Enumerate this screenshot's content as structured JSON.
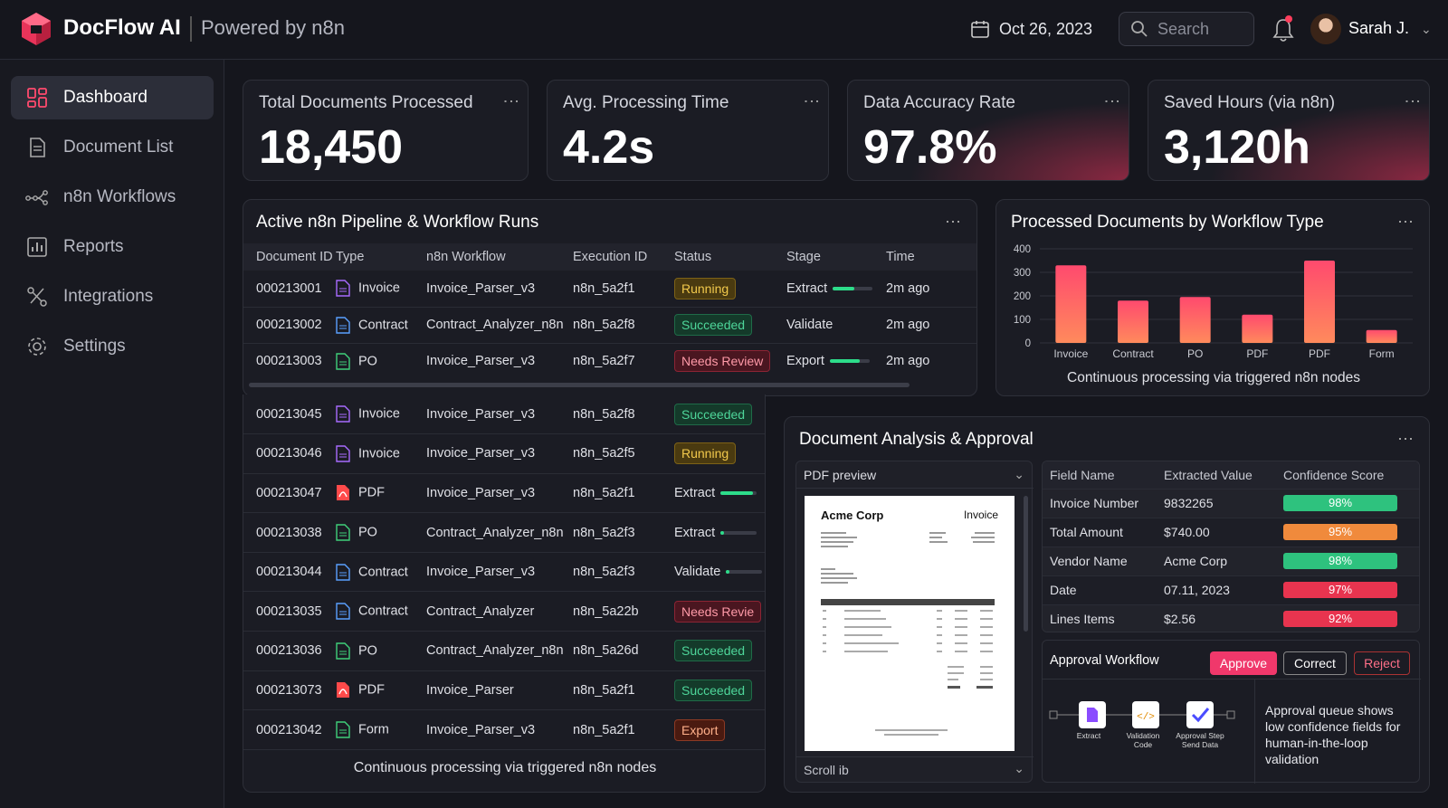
{
  "app": {
    "name": "DocFlow AI",
    "subtitle": "Powered by n8n"
  },
  "header": {
    "date": "Oct 26, 2023",
    "search_placeholder": "Search",
    "user": "Sarah J."
  },
  "sidebar": {
    "items": [
      {
        "label": "Dashboard",
        "icon": "dashboard-icon",
        "active": true
      },
      {
        "label": "Document List",
        "icon": "document-icon"
      },
      {
        "label": "n8n Workflows",
        "icon": "workflow-icon"
      },
      {
        "label": "Reports",
        "icon": "reports-icon"
      },
      {
        "label": "Integrations",
        "icon": "integrations-icon"
      },
      {
        "label": "Settings",
        "icon": "gear-icon"
      }
    ]
  },
  "kpis": [
    {
      "title": "Total Documents Processed",
      "value": "18,450"
    },
    {
      "title": "Avg. Processing Time",
      "value": "4.2s"
    },
    {
      "title": "Data Accuracy Rate",
      "value": "97.8%"
    },
    {
      "title": "Saved Hours (via n8n)",
      "value": "3,120h"
    }
  ],
  "pipeline": {
    "title": "Active n8n Pipeline & Workflow Runs",
    "columns": [
      "Document ID",
      "Type",
      "n8n Workflow",
      "Execution ID",
      "Status",
      "Stage",
      "Time"
    ],
    "rows": [
      {
        "id": "000213001",
        "type": "Invoice",
        "workflow": "Invoice_Parser_v3",
        "exec": "n8n_5a2f1",
        "status": "Running",
        "stage": "Extract",
        "progress": 0.55,
        "time": "2m ago"
      },
      {
        "id": "000213002",
        "type": "Contract",
        "workflow": "Contract_Analyzer_n8n",
        "exec": "n8n_5a2f8",
        "status": "Succeeded",
        "stage": "Validate",
        "progress": null,
        "time": "2m ago"
      },
      {
        "id": "000213003",
        "type": "PO",
        "workflow": "Invoice_Parser_v3",
        "exec": "n8n_5a2f7",
        "status": "Needs Review",
        "stage": "Export",
        "progress": 0.75,
        "time": "2m ago"
      }
    ],
    "more_rows": [
      {
        "id": "000213045",
        "type": "Invoice",
        "workflow": "Invoice_Parser_v3",
        "exec": "n8n_5a2f8",
        "status": "Succeeded",
        "stage": ""
      },
      {
        "id": "000213046",
        "type": "Invoice",
        "workflow": "Invoice_Parser_v3",
        "exec": "n8n_5a2f5",
        "status": "Running",
        "stage": ""
      },
      {
        "id": "000213047",
        "type": "PDF",
        "workflow": "Invoice_Parser_v3",
        "exec": "n8n_5a2f1",
        "status": "",
        "stage": "Extract"
      },
      {
        "id": "000213038",
        "type": "PO",
        "workflow": "Contract_Analyzer_n8n",
        "exec": "n8n_5a2f3",
        "status": "",
        "stage": "Extract"
      },
      {
        "id": "000213044",
        "type": "Contract",
        "workflow": "Invoice_Parser_v3",
        "exec": "n8n_5a2f3",
        "status": "",
        "stage": "Validate"
      },
      {
        "id": "000213035",
        "type": "Contract",
        "workflow": "Contract_Analyzer",
        "exec": "n8n_5a22b",
        "status": "Needs Revie",
        "stage": ""
      },
      {
        "id": "000213036",
        "type": "PO",
        "workflow": "Contract_Analyzer_n8n",
        "exec": "n8n_5a26d",
        "status": "Succeeded",
        "stage": ""
      },
      {
        "id": "000213073",
        "type": "PDF",
        "workflow": "Invoice_Parser",
        "exec": "n8n_5a2f1",
        "status": "Succeeded",
        "stage": ""
      },
      {
        "id": "000213042",
        "type": "Form",
        "workflow": "Invoice_Parser_v3",
        "exec": "n8n_5a2f1",
        "status": "Export",
        "stage": ""
      }
    ],
    "footer": "Continuous processing via triggered n8n nodes"
  },
  "chart_data": {
    "type": "bar",
    "title": "Processed Documents by Workflow Type",
    "categories": [
      "Invoice",
      "Contract",
      "PO",
      "PDF",
      "PDF",
      "Form"
    ],
    "values": [
      330,
      180,
      195,
      120,
      350,
      55
    ],
    "ylim": [
      0,
      400
    ],
    "yticks": [
      0,
      100,
      200,
      300,
      400
    ],
    "grid": true,
    "caption": "Continuous processing via triggered n8n nodes",
    "bar_color_top": "#ff4a6e",
    "bar_color_bottom": "#ff8a5c"
  },
  "analysis": {
    "title": "Document Analysis & Approval",
    "preview_label": "PDF preview",
    "scroll_label": "Scroll ib",
    "doc_company": "Acme Corp",
    "doc_kind": "Invoice",
    "columns": [
      "Field Name",
      "Extracted Value",
      "Confidence Score"
    ],
    "fields": [
      {
        "name": "Invoice Number",
        "value": "9832265",
        "confidence": "98%",
        "color": "#2ec27e"
      },
      {
        "name": "Total Amount",
        "value": "$740.00",
        "confidence": "95%",
        "color": "#f08a3c"
      },
      {
        "name": "Vendor Name",
        "value": "Acme Corp",
        "confidence": "98%",
        "color": "#2ec27e"
      },
      {
        "name": "Date",
        "value": "07.11, 2023",
        "confidence": "97%",
        "color": "#e8344f"
      },
      {
        "name": "Lines Items",
        "value": "$2.56",
        "confidence": "92%",
        "color": "#e8344f"
      }
    ],
    "approval": {
      "title": "Approval Workflow",
      "approve": "Approve",
      "correct": "Correct",
      "reject": "Reject",
      "steps": [
        "Extract",
        "Validation Code",
        "Approval Step Send Data"
      ],
      "note": "Approval queue shows low confidence fields for human-in-the-loop validation"
    }
  }
}
